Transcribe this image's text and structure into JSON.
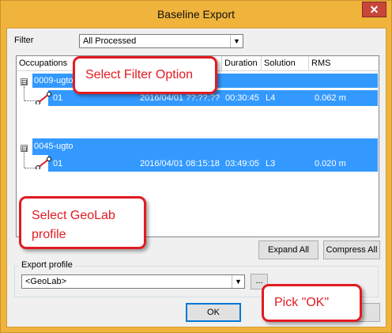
{
  "window": {
    "title": "Baseline Export",
    "close_glyph": "✕"
  },
  "filter": {
    "label": "Filter",
    "selected": "All Processed"
  },
  "table": {
    "columns": [
      "Occupations",
      "Duration",
      "Solution",
      "RMS"
    ],
    "groups": [
      {
        "name": "0009-ugto",
        "expand_glyph": "⊟",
        "row": {
          "occupation": "01",
          "time": "2016/04/01 ??:??:??",
          "duration": "00:30:45",
          "solution": "L4",
          "rms": "0.062 m"
        }
      },
      {
        "name": "0045-ugto",
        "expand_glyph": "⊟",
        "row": {
          "occupation": "01",
          "time": "2016/04/01 08:15:18",
          "duration": "03:49:05",
          "solution": "L3",
          "rms": "0.020 m"
        }
      }
    ]
  },
  "buttons": {
    "expand_all": "Expand All",
    "compress_all": "Compress All",
    "browse": "...",
    "ok": "OK"
  },
  "export_profile": {
    "label": "Export profile",
    "selected": "<GeoLab>"
  },
  "callouts": {
    "filter": "Select Filter Option",
    "profile": "Select GeoLab profile",
    "ok": "Pick \"OK\""
  },
  "colors": {
    "selection": "#3399ff",
    "callout_border": "#e11b22",
    "title_bar": "#f0b33c",
    "close_button": "#c7463a"
  }
}
